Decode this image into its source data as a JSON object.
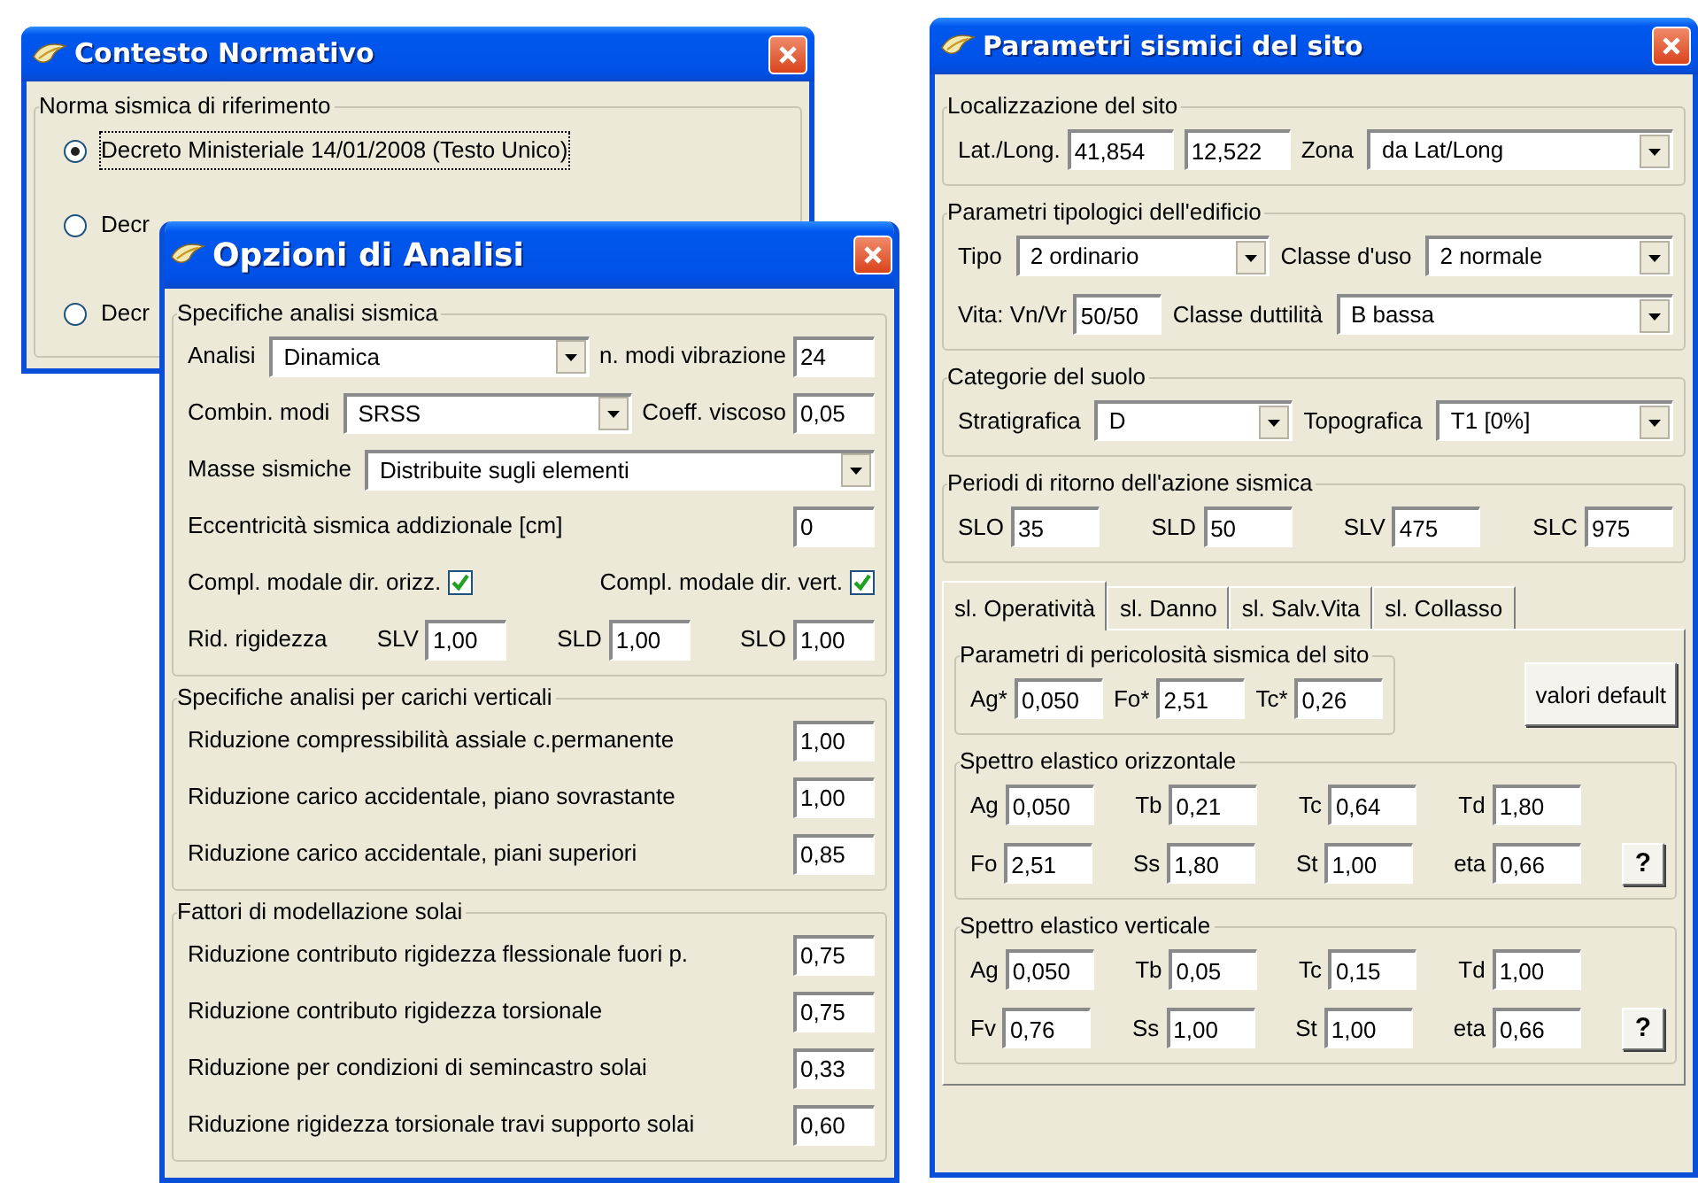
{
  "contesto_normativo": {
    "title": "Contesto Normativo",
    "group": "Norma sismica di riferimento",
    "options": [
      {
        "label": "Decreto Ministeriale 14/01/2008 (Testo Unico)",
        "selected": true
      },
      {
        "label": "Decr",
        "selected": false
      },
      {
        "label": "Decr",
        "selected": false
      }
    ]
  },
  "opzioni_analisi": {
    "title": "Opzioni di Analisi",
    "sections": [
      {
        "legend": "Specifiche analisi sismica",
        "rows": [
          [
            {
              "kind": "select",
              "label": "Analisi",
              "value": "Dinamica"
            },
            {
              "kind": "field",
              "label": "n. modi vibrazione",
              "value": "24"
            }
          ],
          [
            {
              "kind": "select",
              "label": "Combin. modi",
              "value": "SRSS"
            },
            {
              "kind": "field",
              "label": "Coeff. viscoso",
              "value": "0,05"
            }
          ],
          [
            {
              "kind": "select",
              "label": "Masse sismiche",
              "value": "Distribuite sugli elementi"
            }
          ],
          [
            {
              "kind": "field",
              "label": "Eccentricità sismica addizionale [cm]",
              "value": "0"
            }
          ],
          [
            {
              "kind": "check",
              "label": "Compl. modale dir. orizz.",
              "checked": true
            },
            {
              "kind": "check",
              "label": "Compl. modale dir. vert.",
              "checked": true
            }
          ],
          [
            {
              "kind": "group",
              "label": "Rid. rigidezza",
              "fields": [
                {
                  "label": "SLV",
                  "value": "1,00"
                },
                {
                  "label": "SLD",
                  "value": "1,00"
                },
                {
                  "label": "SLO",
                  "value": "1,00"
                }
              ]
            }
          ]
        ]
      },
      {
        "legend": "Specifiche analisi per carichi verticali",
        "rows": [
          [
            {
              "kind": "field",
              "label": "Riduzione compressibilità assiale c.permanente",
              "value": "1,00"
            }
          ],
          [
            {
              "kind": "field",
              "label": "Riduzione carico accidentale, piano sovrastante",
              "value": "1,00"
            }
          ],
          [
            {
              "kind": "field",
              "label": "Riduzione carico accidentale, piani superiori",
              "value": "0,85"
            }
          ]
        ]
      },
      {
        "legend": "Fattori di modellazione solai",
        "rows": [
          [
            {
              "kind": "field",
              "label": "Riduzione contributo rigidezza flessionale fuori p.",
              "value": "0,75"
            }
          ],
          [
            {
              "kind": "field",
              "label": "Riduzione contributo rigidezza torsionale",
              "value": "0,75"
            }
          ],
          [
            {
              "kind": "field",
              "label": "Riduzione per condizioni di semincastro solai",
              "value": "0,33"
            }
          ],
          [
            {
              "kind": "field",
              "label": "Riduzione rigidezza torsionale travi supporto solai",
              "value": "0,60"
            }
          ]
        ]
      }
    ]
  },
  "parametri_sito": {
    "title": "Parametri sismici del sito",
    "sections": [
      {
        "legend": "Localizzazione del sito",
        "rows": [
          [
            {
              "kind": "field",
              "label": "Lat./Long.",
              "value": "41,854"
            },
            {
              "kind": "input",
              "value": "12,522"
            },
            {
              "kind": "select",
              "label": "Zona",
              "value": "da Lat/Long"
            }
          ]
        ]
      },
      {
        "legend": "Parametri tipologici dell'edificio",
        "rows": [
          [
            {
              "kind": "select",
              "label": "Tipo",
              "value": "2 ordinario"
            },
            {
              "kind": "select",
              "label": "Classe d'uso",
              "value": "2 normale"
            }
          ],
          [
            {
              "kind": "field",
              "label": "Vita: Vn/Vr",
              "value": "50/50"
            },
            {
              "kind": "select",
              "label": "Classe duttilità",
              "value": "B bassa"
            }
          ]
        ]
      },
      {
        "legend": "Categorie del suolo",
        "rows": [
          [
            {
              "kind": "select",
              "label": "Stratigrafica",
              "value": "D"
            },
            {
              "kind": "select",
              "label": "Topografica",
              "value": "T1  [0%]"
            }
          ]
        ]
      },
      {
        "legend": "Periodi di ritorno dell'azione sismica",
        "rows": [
          [
            {
              "kind": "field",
              "label": "SLO",
              "value": "35"
            },
            {
              "kind": "field",
              "label": "SLD",
              "value": "50"
            },
            {
              "kind": "field",
              "label": "SLV",
              "value": "475"
            },
            {
              "kind": "field",
              "label": "SLC",
              "value": "975"
            }
          ]
        ]
      }
    ],
    "tabs": [
      {
        "label": "sl. Operatività",
        "selected": true
      },
      {
        "label": "sl. Danno",
        "selected": false
      },
      {
        "label": "sl. Salv.Vita",
        "selected": false
      },
      {
        "label": "sl. Collasso",
        "selected": false
      }
    ],
    "panel": {
      "group": {
        "legend": "Parametri di pericolosità sismica del sito",
        "rows": [
          [
            {
              "kind": "field",
              "label": "Ag*",
              "value": "0,050"
            },
            {
              "kind": "field",
              "label": "Fo*",
              "value": "2,51"
            },
            {
              "kind": "field",
              "label": "Tc*",
              "value": "0,26"
            }
          ]
        ]
      },
      "button": "valori default",
      "groups": [
        {
          "legend": "Spettro elastico orizzontale",
          "rows": [
            [
              {
                "kind": "field",
                "label": "Ag",
                "value": "0,050"
              },
              {
                "kind": "field",
                "label": "Tb",
                "value": "0,21"
              },
              {
                "kind": "field",
                "label": "Tc",
                "value": "0,64"
              },
              {
                "kind": "field",
                "label": "Td",
                "value": "1,80"
              },
              {
                "kind": "spacer"
              }
            ],
            [
              {
                "kind": "field",
                "label": "Fo",
                "value": "2,51"
              },
              {
                "kind": "field",
                "label": "Ss",
                "value": "1,80"
              },
              {
                "kind": "field",
                "label": "St",
                "value": "1,00"
              },
              {
                "kind": "field",
                "label": "eta",
                "value": "0,66"
              },
              {
                "kind": "button",
                "label": "?"
              }
            ]
          ]
        },
        {
          "legend": "Spettro elastico verticale",
          "rows": [
            [
              {
                "kind": "field",
                "label": "Ag",
                "value": "0,050"
              },
              {
                "kind": "field",
                "label": "Tb",
                "value": "0,05"
              },
              {
                "kind": "field",
                "label": "Tc",
                "value": "0,15"
              },
              {
                "kind": "field",
                "label": "Td",
                "value": "1,00"
              },
              {
                "kind": "spacer"
              }
            ],
            [
              {
                "kind": "field",
                "label": "Fv",
                "value": "0,76"
              },
              {
                "kind": "field",
                "label": "Ss",
                "value": "1,00"
              },
              {
                "kind": "field",
                "label": "St",
                "value": "1,00"
              },
              {
                "kind": "field",
                "label": "eta",
                "value": "0,66"
              },
              {
                "kind": "button",
                "label": "?"
              }
            ]
          ]
        }
      ]
    }
  }
}
